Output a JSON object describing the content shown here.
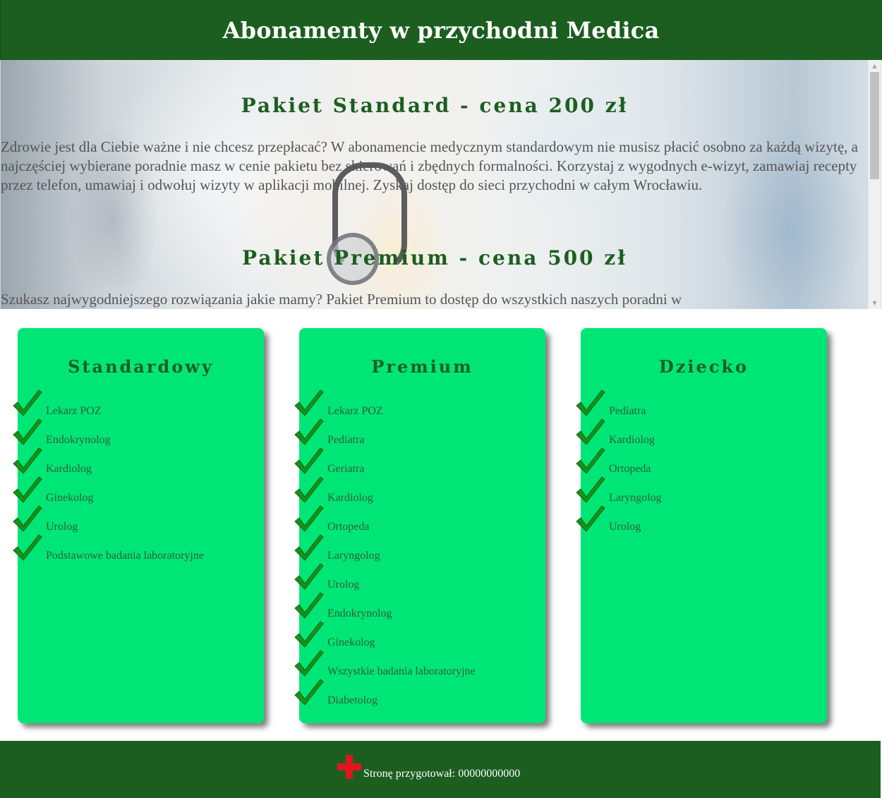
{
  "header": {
    "title": "Abonamenty w przychodni Medica"
  },
  "hero": {
    "standard_heading": "Pakiet Standard - cena 200 zł",
    "standard_text": "Zdrowie jest dla Ciebie ważne i nie chcesz przepłacać? W abonamencie medycznym standardowym nie musisz płacić osobno za każdą wizytę, a najczęściej wybierane poradnie masz w cenie pakietu bez skierowań i zbędnych formalności. Korzystaj z wygodnych e-wizyt, zamawiaj recepty przez telefon, umawiaj i odwołuj wizyty w aplikacji mobilnej. Zyskaj dostęp do sieci przychodni w całym Wrocławiu.",
    "premium_heading": "Pakiet Premium - cena 500 zł",
    "premium_text": "Szukasz najwygodniejszego rozwiązania jakie mamy? Pakiet Premium to dostęp do wszystkich naszych poradni w"
  },
  "scrollbar": {
    "up_icon": "triangle-up",
    "down_icon": "triangle-down"
  },
  "cards": [
    {
      "title": "Standardowy",
      "items": [
        "Lekarz POZ",
        "Endokrynolog",
        "Kardiolog",
        "Ginekolog",
        "Urolog",
        "Podstawowe badania laboratoryjne"
      ]
    },
    {
      "title": "Premium",
      "items": [
        "Lekarz POZ",
        "Pediatra",
        "Geriatra",
        "Kardiolog",
        "Ortopeda",
        "Laryngolog",
        "Urolog",
        "Endokrynolog",
        "Ginekolog",
        "Wszystkie badania laboratoryjne",
        "Diabetolog"
      ]
    },
    {
      "title": "Dziecko",
      "items": [
        "Pediatra",
        "Kardiolog",
        "Ortopeda",
        "Laryngolog",
        "Urolog"
      ]
    }
  ],
  "colors": {
    "header_bg": "#1c5e20",
    "card_bg": "#00e676",
    "check_green": "#1a8f1a",
    "cross_red": "#e0161c"
  },
  "footer": {
    "text": "Stronę przygotował: 00000000000",
    "icon": "red-cross-icon"
  }
}
